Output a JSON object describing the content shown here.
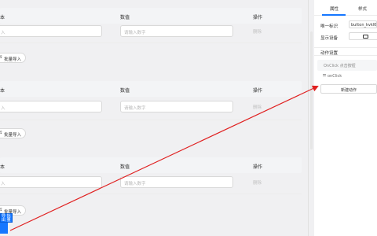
{
  "table": {
    "col_text": "本",
    "col_value": "数值",
    "col_action": "操作"
  },
  "rows": [
    {
      "text_placeholder": "入",
      "value_placeholder": "请输入数字",
      "delete_label": "删除"
    },
    {
      "text_placeholder": "入",
      "value_placeholder": "请输入数字",
      "delete_label": "删除"
    },
    {
      "text_placeholder": "入",
      "value_placeholder": "请输入数字",
      "delete_label": "删除"
    }
  ],
  "import_label": "批量导入",
  "selected_component": {
    "line1": "导 批",
    "line2": "出 量"
  },
  "panel": {
    "tabs": [
      "属性",
      "样式"
    ],
    "unique_id_label": "唯一标识",
    "unique_id_value": "button_kvkl0",
    "show_device_label": "显示设备",
    "action_section": "动作设置",
    "onclick_placeholder": "OnClick 点击按钮",
    "onclick_item": "onClick",
    "new_action_label": "新建动作"
  },
  "colors": {
    "accent": "#1677ff",
    "arrow": "#e02020"
  }
}
